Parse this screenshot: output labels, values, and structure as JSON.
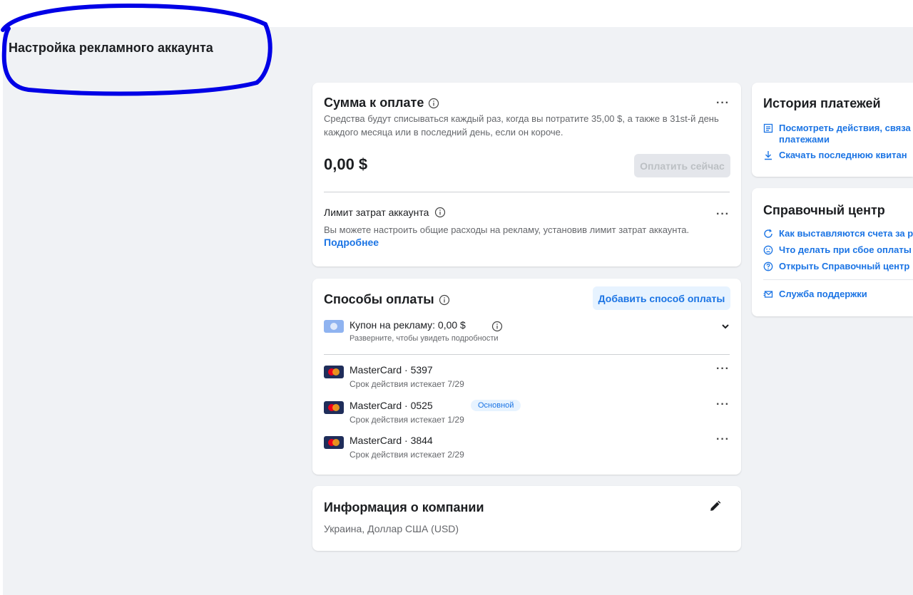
{
  "page": {
    "title": "Настройка рекламного аккаунта"
  },
  "amount_due": {
    "title": "Сумма к оплате",
    "description": "Средства будут списываться каждый раз, когда вы потратите 35,00 $, а также в 31st-й день каждого месяца или в последний день, если он короче.",
    "amount": "0,00 $",
    "pay_button": "Оплатить сейчас",
    "limit_title": "Лимит затрат аккаунта",
    "limit_description": "Вы можете настроить общие расходы на рекламу, установив лимит затрат аккаунта.",
    "limit_link": "Подробнее",
    "more": "···"
  },
  "payment_methods": {
    "title": "Способы оплаты",
    "add_button": "Добавить способ оплаты",
    "coupon": {
      "label": "Купон на рекламу: 0,00 $",
      "sub": "Разверните, чтобы увидеть подробности"
    },
    "cards": [
      {
        "name": "MasterCard · 5397",
        "expiry": "Срок действия истекает 7/29",
        "badge": ""
      },
      {
        "name": "MasterCard · 0525",
        "expiry": "Срок действия истекает 1/29",
        "badge": "Основной"
      },
      {
        "name": "MasterCard · 3844",
        "expiry": "Срок действия истекает 2/29",
        "badge": ""
      }
    ],
    "more": "···"
  },
  "company_info": {
    "title": "Информация о компании",
    "details": "Украина, Доллар США (USD)"
  },
  "payment_history": {
    "title": "История платежей",
    "link_activity_1": "Посмотреть действия, связа",
    "link_activity_2": "платежами",
    "link_receipt": "Скачать последнюю квитан"
  },
  "help_center": {
    "title": "Справочный центр",
    "links": [
      "Как выставляются счета за р",
      "Что делать при сбое оплаты",
      "Открыть Справочный центр"
    ],
    "support": "Служба поддержки"
  },
  "colors": {
    "accent": "#1b74e4",
    "annotation": "#0000e6",
    "background": "#f0f2f5"
  }
}
